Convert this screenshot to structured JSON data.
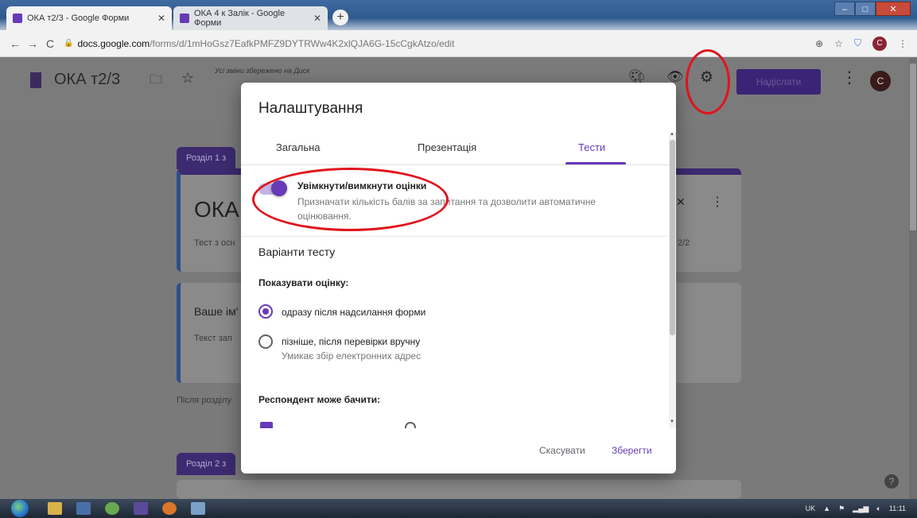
{
  "browser": {
    "tabs": [
      {
        "title": "ОКА т2/3 - Google Форми",
        "active": true
      },
      {
        "title": "ОКА 4 к Залік - Google Форми",
        "active": false
      }
    ],
    "new_tab_label": "+",
    "url_host": "docs.google.com",
    "url_path": "/forms/d/1mHoGsz7EafkPMFZ9DYTRWw4K2xlQJA6G-15cCgkAtzo/edit",
    "avatar_letter": "C"
  },
  "forms_header": {
    "title": "ОКА т2/3",
    "saved_status": "Усі зміни збережено на Диск",
    "send_label": "Надіслати",
    "avatar_letter": "C"
  },
  "background": {
    "section1_badge": "Розділ 1 з",
    "form_title": "ОКА",
    "form_desc": "Тест з осн",
    "points_fragment": "2/2",
    "question_title": "Ваше ім'",
    "answer_placeholder": "Текст зап",
    "after_section": "Після розділу",
    "section2_badge": "Розділ 2 з"
  },
  "modal": {
    "title": "Налаштування",
    "tabs": [
      "Загальна",
      "Презентація",
      "Тести"
    ],
    "active_tab": "Тести",
    "grading": {
      "title": "Увімкнути/вимкнути оцінки",
      "description": "Призначати кількість балів за запитання та дозволити автоматичне оцінювання.",
      "enabled": true
    },
    "quiz_options_title": "Варіанти тесту",
    "show_grade_title": "Показувати оцінку:",
    "show_grade_options": [
      {
        "label": "одразу після надсилання форми",
        "checked": true,
        "sub": ""
      },
      {
        "label": "пізніше, після перевірки вручну",
        "checked": false,
        "sub": "Умикає збір електронних адрес"
      }
    ],
    "respondent_title": "Респондент може бачити:",
    "cancel_label": "Скасувати",
    "save_label": "Зберегти"
  },
  "taskbar": {
    "language": "UK",
    "time": "11:11"
  },
  "colors": {
    "accent": "#673ab7",
    "annotation_red": "#e0141e"
  }
}
